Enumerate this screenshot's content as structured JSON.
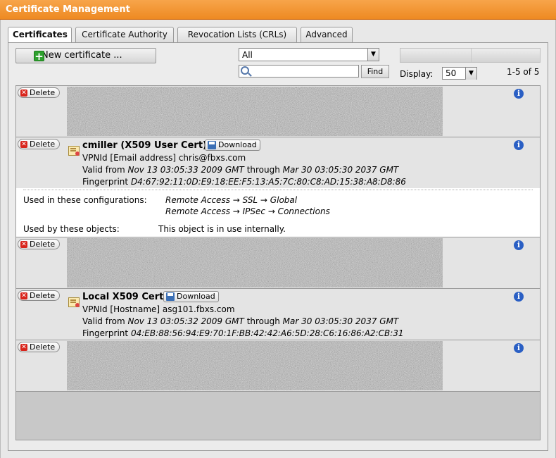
{
  "window": {
    "title": "Certificate Management"
  },
  "tabs": [
    {
      "label": "Certificates",
      "active": true
    },
    {
      "label": "Certificate Authority",
      "active": false
    },
    {
      "label": "Revocation Lists (CRLs)",
      "active": false
    },
    {
      "label": "Advanced",
      "active": false
    }
  ],
  "toolbar": {
    "new_label": "New certificate ...",
    "filter_value": "All",
    "search_value": "",
    "find_label": "Find",
    "display_label": "Display:",
    "display_value": "50",
    "count_label": "1-5 of 5"
  },
  "labels": {
    "delete": "Delete",
    "download": "Download",
    "valid_from": "Valid from",
    "through": "through",
    "fingerprint": "Fingerprint"
  },
  "certificates": [
    {
      "redacted": true
    },
    {
      "name": "cmiller (X509 User Cert)",
      "vpnid": "VPNId [Email address] chris@fbxs.com",
      "valid_from": "Nov 13 03:05:33 2009 GMT",
      "valid_to": "Mar 30 03:05:30 2037 GMT",
      "fingerprint": "D4:67:92:11:0D:E9:18:EE:F5:13:A5:7C:80:C8:AD:15:38:A8:D8:86",
      "details": {
        "configs_label": "Used in these configurations:",
        "config1": "Remote Access → SSL → Global",
        "config2": "Remote Access → IPSec → Connections",
        "objects_label": "Used by these objects:",
        "objects_value": "This object is in use internally."
      }
    },
    {
      "redacted": true
    },
    {
      "name": "Local X509 Cert",
      "vpnid": "VPNId [Hostname] asg101.fbxs.com",
      "valid_from": "Nov 13 03:05:32 2009 GMT",
      "valid_to": "Mar 30 03:05:30 2037 GMT",
      "fingerprint": "04:EB:88:56:94:E9:70:1F:BB:42:42:A6:5D:28:C6:16:86:A2:CB:31"
    },
    {
      "redacted": true
    }
  ],
  "colors": {
    "title_bar": "#ee8a22",
    "delete_icon": "#d8241b",
    "info_icon": "#2a5fc4",
    "add_icon": "#2ea12e"
  }
}
